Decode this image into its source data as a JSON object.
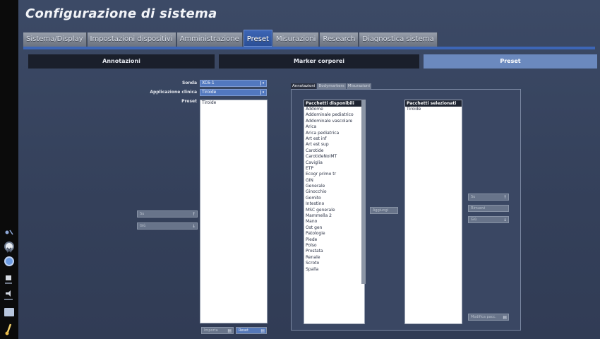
{
  "window": {
    "title": "Configurazione di sistema"
  },
  "top_tabs": [
    {
      "label": "Sistema/Display",
      "active": false
    },
    {
      "label": "Impostazioni dispositivi",
      "active": false
    },
    {
      "label": "Amministrazione",
      "active": false
    },
    {
      "label": "Preset",
      "active": true
    },
    {
      "label": "Misurazioni",
      "active": false
    },
    {
      "label": "Research",
      "active": false
    },
    {
      "label": "Diagnostica sistema",
      "active": false
    }
  ],
  "sub_tabs": [
    {
      "label": "Annotazioni",
      "active": false
    },
    {
      "label": "Marker corporei",
      "active": false
    },
    {
      "label": "Preset",
      "active": true
    }
  ],
  "form": {
    "sonda_label": "Sonda",
    "sonda_value": "XC6-1",
    "applicazione_label": "Applicazione clinica",
    "applicazione_value": "Tiroide",
    "preset_label": "Preset",
    "preset_items": [
      "Tiroide"
    ],
    "su_label": "Su",
    "giu_label": "Giù",
    "importa_label": "Importa",
    "reset_label": "Reset"
  },
  "panel": {
    "tabs": [
      {
        "label": "Annotazioni",
        "active": true
      },
      {
        "label": "Bodymarkers",
        "active": false
      },
      {
        "label": "Misurazioni",
        "active": false
      }
    ],
    "available_header": "Pacchetti disponibili",
    "available_items": [
      "Addome",
      "Addominale pediatrico",
      "Addominale vascolare",
      "Arica",
      "Arica pediatrica",
      "Art est inf",
      "Art est sup",
      "Carotide",
      "CarotideNoIMT",
      "Caviglia",
      "ETP",
      "Ecogr primo tr",
      "GIN",
      "Generale",
      "Ginocchio",
      "Gomito",
      "Intestino",
      "MSC generale",
      "Mammella 2",
      "Mano",
      "Ost gen",
      "Patologie",
      "Piede",
      "Polso",
      "Prostata",
      "Renale",
      "Scroto",
      "Spalla"
    ],
    "selected_header": "Pacchetti selezionati",
    "selected_items": [
      "Tiroide"
    ],
    "aggiungi_label": "Aggiungi",
    "su_label": "Su",
    "rimuovi_label": "Rimuovi",
    "giu_label": "Giù",
    "modifica_label": "Modifica pacc."
  },
  "sidebar": {
    "icons": [
      "probe-icon",
      "freeze-icon",
      "globe-icon",
      "save-icon",
      "volume-icon",
      "image-icon",
      "brush-icon"
    ]
  },
  "colors": {
    "accent": "#3d66b6",
    "background": "#35425d",
    "tab_inactive": "#7b828f"
  }
}
